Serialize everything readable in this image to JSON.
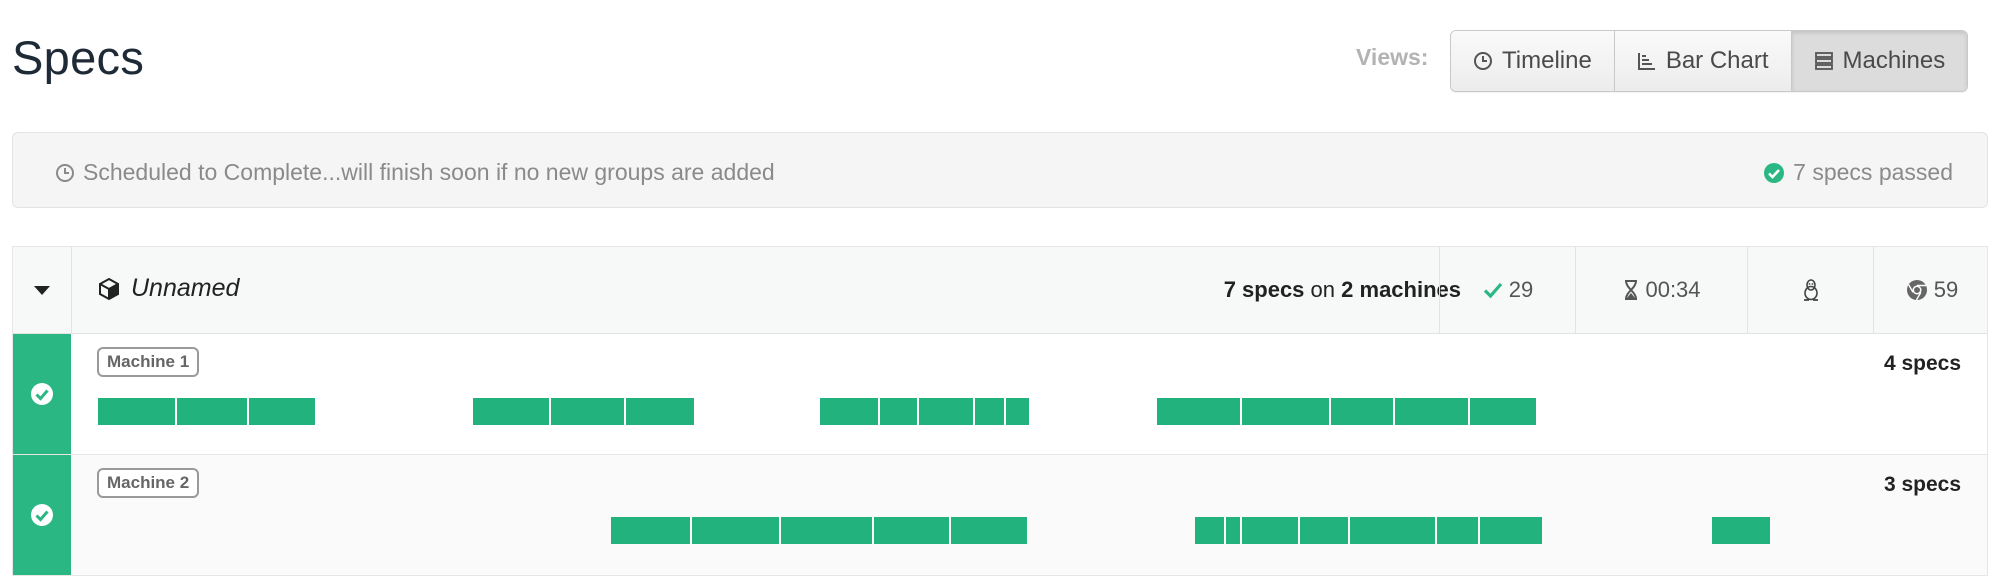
{
  "page": {
    "title": "Specs"
  },
  "views": {
    "label": "Views:",
    "buttons": [
      {
        "label": "Timeline",
        "icon": "clock-icon"
      },
      {
        "label": "Bar Chart",
        "icon": "bar-chart-icon"
      },
      {
        "label": "Machines",
        "icon": "server-icon",
        "active": true
      }
    ]
  },
  "status": {
    "message": "Scheduled to Complete...will finish soon if no new groups are added",
    "passed": "7 specs passed",
    "accent": "#2bb784"
  },
  "group": {
    "name": "Unnamed",
    "specs_count": "7 specs",
    "on": "on",
    "machines_count": "2 machines",
    "passed": "29",
    "duration": "00:34",
    "os_icon": "linux-icon",
    "browser_icon": "chrome-icon",
    "browser_version": "59"
  },
  "machines": [
    {
      "label": "Machine 1",
      "specs": "4 specs",
      "passed": true,
      "segments": [
        [
          0.0,
          2.05
        ],
        [
          2.05,
          3.9
        ],
        [
          3.9,
          5.65
        ],
        [
          9.7,
          11.7
        ],
        [
          11.7,
          13.65
        ],
        [
          13.65,
          15.45
        ],
        [
          18.65,
          20.2
        ],
        [
          20.2,
          21.2
        ],
        [
          21.2,
          22.65
        ],
        [
          22.65,
          23.45
        ],
        [
          23.45,
          24.1
        ],
        [
          27.35,
          29.55
        ],
        [
          29.55,
          31.85
        ],
        [
          31.85,
          33.5
        ],
        [
          33.5,
          35.45
        ],
        [
          35.45,
          37.2
        ]
      ]
    },
    {
      "label": "Machine 2",
      "specs": "3 specs",
      "passed": true,
      "segments": [
        [
          13.25,
          15.35
        ],
        [
          15.35,
          17.65
        ],
        [
          17.65,
          20.05
        ],
        [
          20.05,
          22.05
        ],
        [
          22.05,
          24.05
        ],
        [
          28.35,
          29.15
        ],
        [
          29.15,
          29.55
        ],
        [
          29.55,
          31.05
        ],
        [
          31.05,
          32.35
        ],
        [
          32.35,
          34.6
        ],
        [
          34.6,
          35.7
        ],
        [
          35.7,
          37.35
        ],
        [
          41.7,
          43.25
        ]
      ]
    }
  ],
  "timeline_total": 43.25
}
